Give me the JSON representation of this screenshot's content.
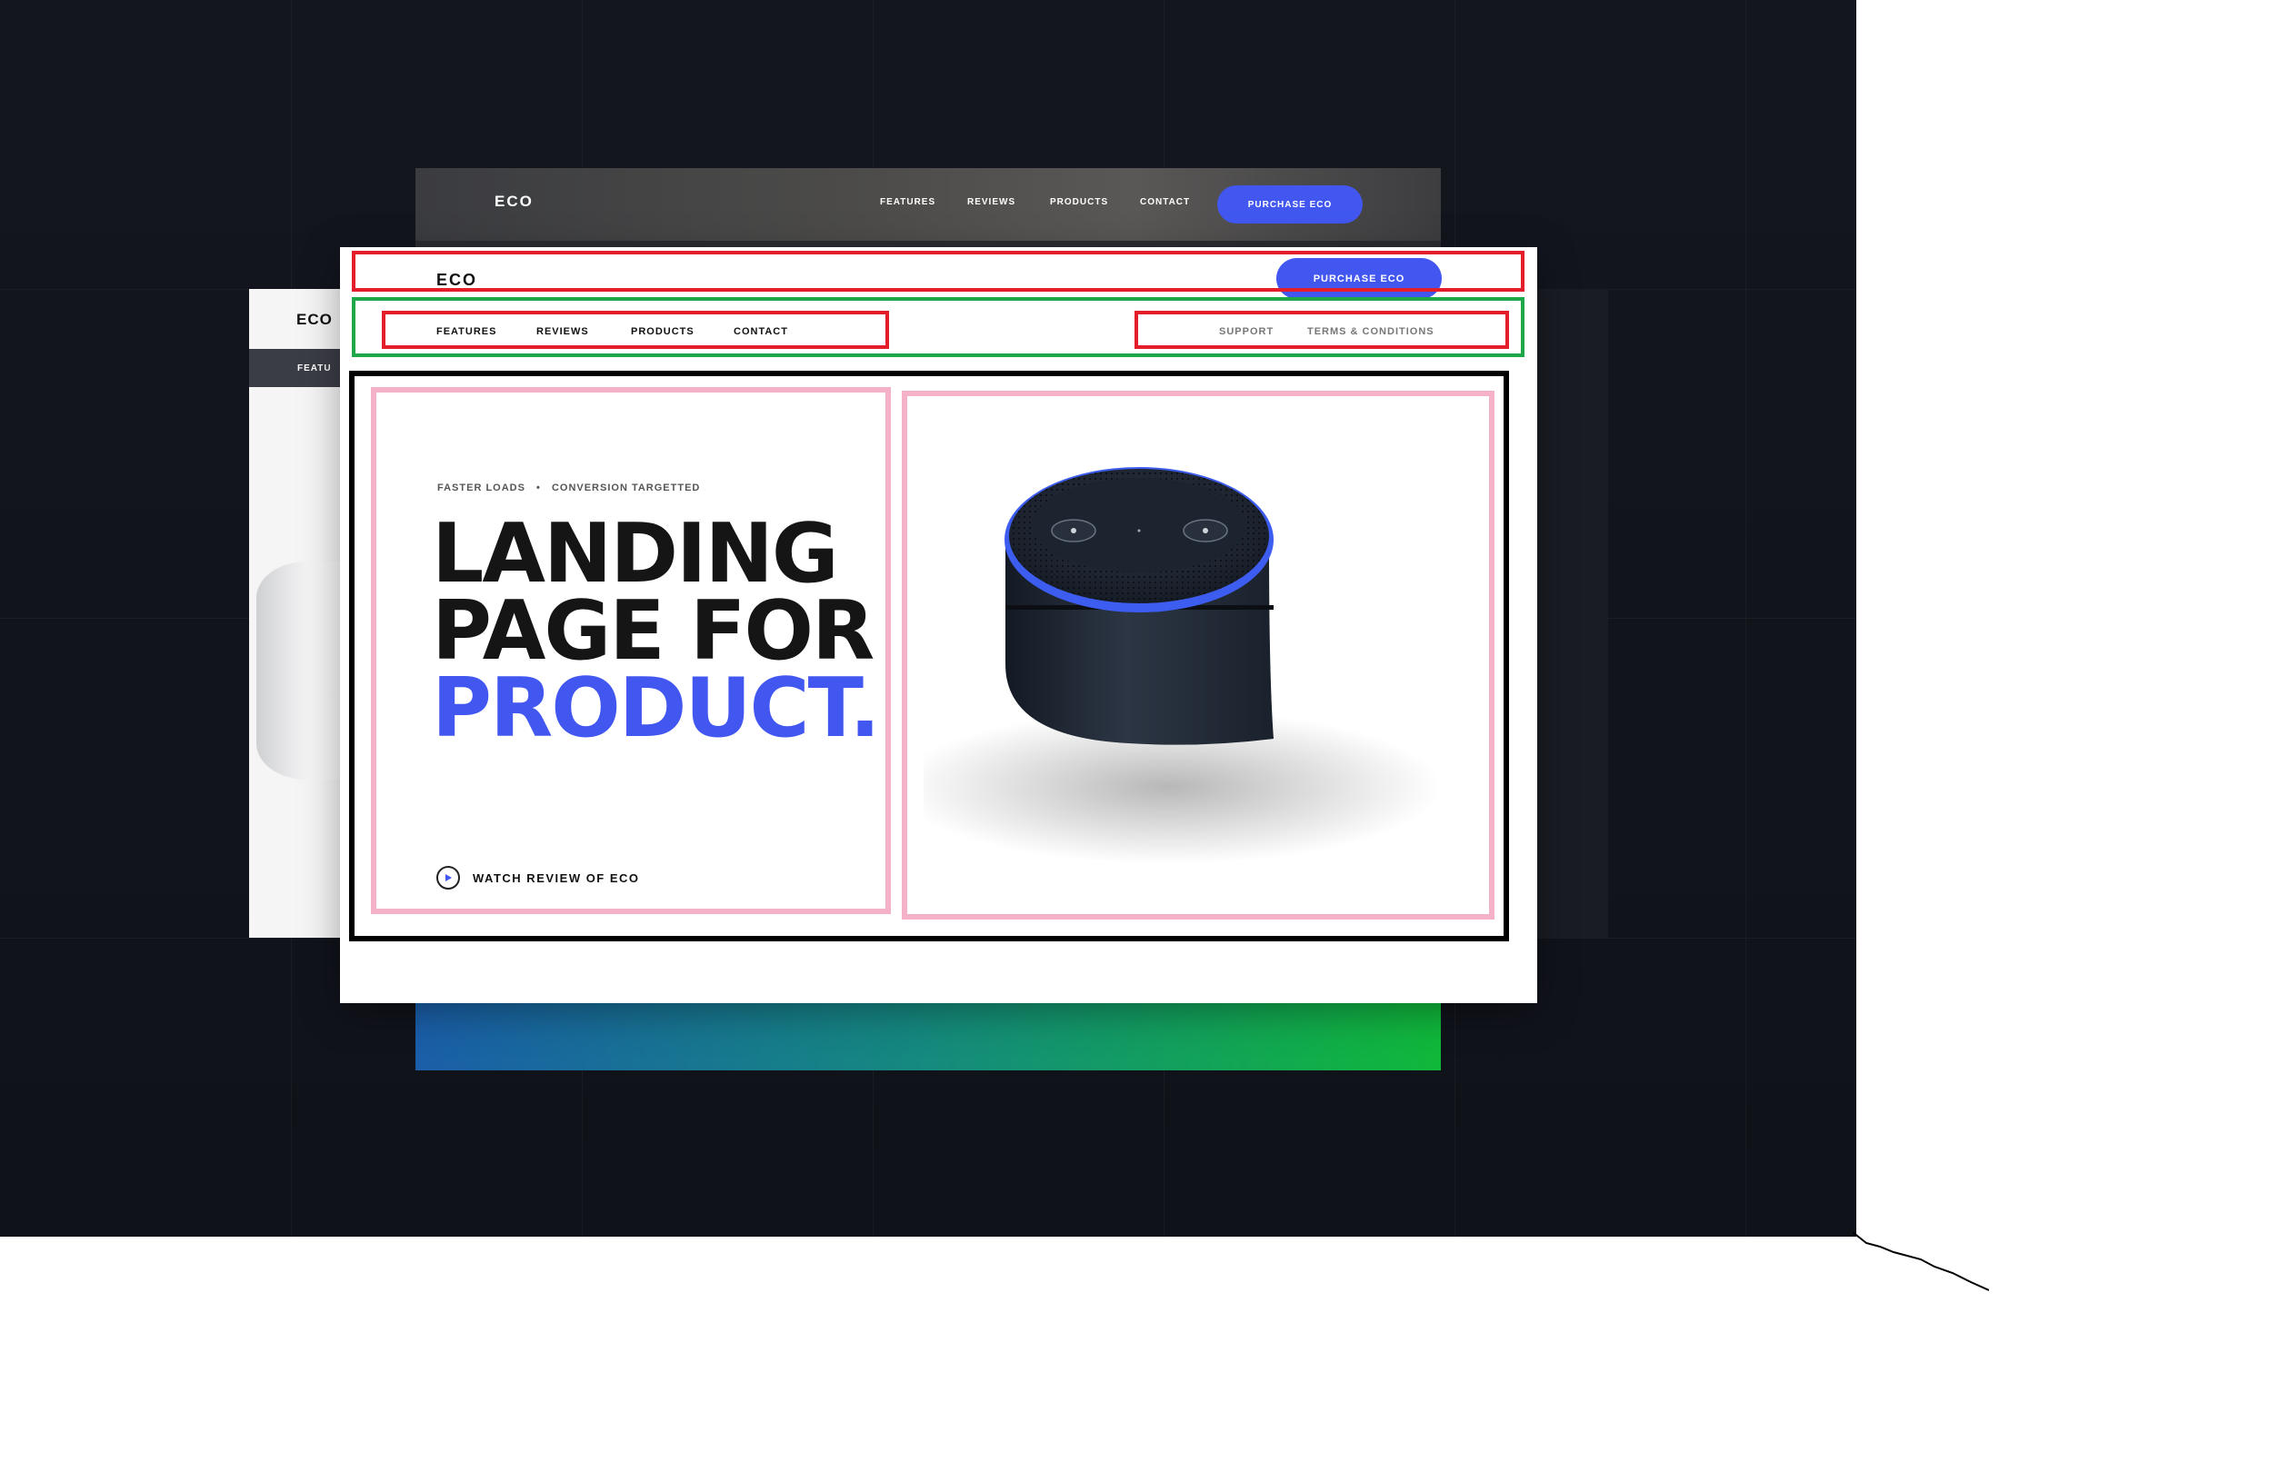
{
  "back_card": {
    "logo": "ECO",
    "nav": [
      "FEATURES",
      "REVIEWS",
      "PRODUCTS",
      "CONTACT"
    ],
    "cta": "PURCHASE ECO",
    "scroll_indicator": "· · · · ˅"
  },
  "left_card": {
    "logo": "ECO",
    "nav_fragment": "FEATU"
  },
  "front_card": {
    "logo": "ECO",
    "cta": "PURCHASE ECO",
    "nav_primary": [
      "FEATURES",
      "REVIEWS",
      "PRODUCTS",
      "CONTACT"
    ],
    "nav_secondary": [
      "SUPPORT",
      "TERMS & CONDITIONS"
    ],
    "hero": {
      "tagline_left": "FASTER LOADS",
      "tagline_sep": "•",
      "tagline_right": "CONVERSION TARGETTED",
      "headline_line1": "LANDING",
      "headline_line2": "PAGE FOR",
      "headline_line3": "PRODUCT.",
      "watch_label": "WATCH REVIEW OF ECO"
    }
  },
  "colors": {
    "accent": "#4157f0",
    "annotation_red": "#e31e2a",
    "annotation_green": "#1ea84a",
    "annotation_pink": "#f5b1c8",
    "annotation_black": "#000000",
    "dark_background": "#14161f"
  },
  "icons": {
    "play": "play-icon"
  }
}
